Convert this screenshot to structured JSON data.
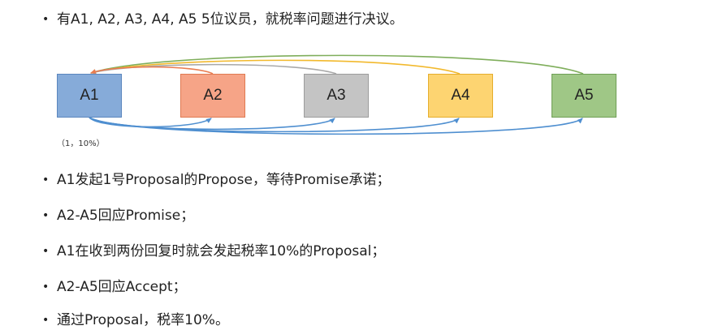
{
  "intro": "有A1, A2, A3, A4, A5 5位议员，就税率问题进行决议。",
  "nodes": [
    "A1",
    "A2",
    "A3",
    "A4",
    "A5"
  ],
  "note": "（1，10%）",
  "steps": [
    "A1发起1号Proposal的Propose，等待Promise承诺；",
    "A2-A5回应Promise；",
    "A1在收到两份回复时就会发起税率10%的Proposal；",
    "A2-A5回应Accept；",
    "通过Proposal，税率10%。"
  ],
  "colors": {
    "a1_fill": "#86abd9",
    "a2_fill": "#f6a487",
    "a3_fill": "#c4c4c4",
    "a4_fill": "#fdd471",
    "a5_fill": "#9fc786",
    "request_arrow": "#4f8fd0",
    "reply_a2": "#ea7c50",
    "reply_a3": "#a9a9a9",
    "reply_a4": "#f2b92d",
    "reply_a5": "#7fae5b"
  }
}
